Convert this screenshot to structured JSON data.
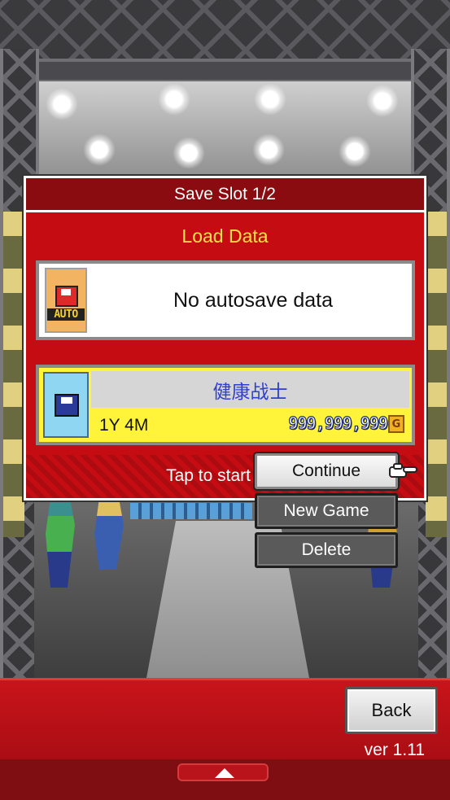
{
  "dialog": {
    "title": "Save Slot 1/2",
    "load_title": "Load Data",
    "autosave": {
      "badge": "AUTO",
      "message": "No autosave data"
    },
    "slot1": {
      "name": "健康战士",
      "time": "1Y 4M",
      "gold": "999,999,999",
      "gold_unit": "G"
    },
    "tap_hint": "Tap to start"
  },
  "context_menu": {
    "items": [
      "Continue",
      "New Game",
      "Delete"
    ]
  },
  "footer": {
    "back_label": "Back",
    "version": "ver 1.11"
  },
  "icons": {
    "autosave": "floppy-disk-red-icon",
    "slot": "floppy-disk-blue-icon",
    "currency": "gold-coin-icon",
    "pointer": "pointing-hand-icon",
    "drawer": "arrow-up-icon"
  }
}
